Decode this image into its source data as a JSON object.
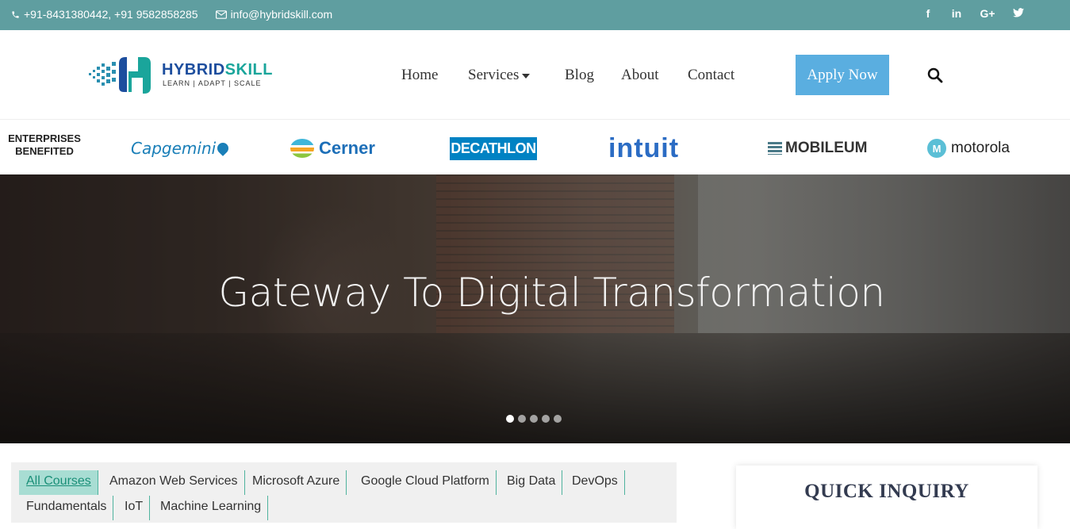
{
  "topbar": {
    "phone": "+91-8431380442, +91 9582858285",
    "email": "info@hybridskill.com",
    "social": [
      {
        "name": "facebook-icon",
        "glyph": "f"
      },
      {
        "name": "linkedin-icon",
        "glyph": "in"
      },
      {
        "name": "google-plus-icon",
        "glyph": "G+"
      },
      {
        "name": "twitter-icon",
        "glyph": "t"
      }
    ]
  },
  "logo": {
    "brand_part1": "HYBRID",
    "brand_part2": "SKILL",
    "tagline": "LEARN | ADAPT | SCALE"
  },
  "nav": {
    "home": "Home",
    "services": "Services",
    "blog": "Blog",
    "about": "About",
    "contact": "Contact",
    "apply": "Apply Now"
  },
  "enterprises": {
    "label_line1": "ENTERPRISES",
    "label_line2": "BENEFITED",
    "logos": {
      "capgemini": "Capgemini",
      "cerner": "Cerner",
      "decathlon": "DECATHLON",
      "intuit": "intuit",
      "mobileum": "MOBILEUM",
      "motorola": "motorola"
    }
  },
  "hero": {
    "title": "Gateway To Digital Transformation",
    "slide_count": 5,
    "active_slide": 1
  },
  "courses": {
    "tabs": [
      "All Courses",
      "Amazon Web Services",
      "Microsoft Azure",
      "Google Cloud Platform",
      "Big Data",
      "DevOps",
      "Fundamentals",
      "IoT",
      "Machine Learning"
    ],
    "active": "All Courses"
  },
  "inquiry": {
    "title": "QUICK INQUIRY"
  },
  "colors": {
    "topbar": "#5f9ea0",
    "apply_button": "#5aaee0",
    "active_tab": "#a8ddd3",
    "brand_blue": "#1d4e9e",
    "brand_teal": "#1aa59b"
  }
}
